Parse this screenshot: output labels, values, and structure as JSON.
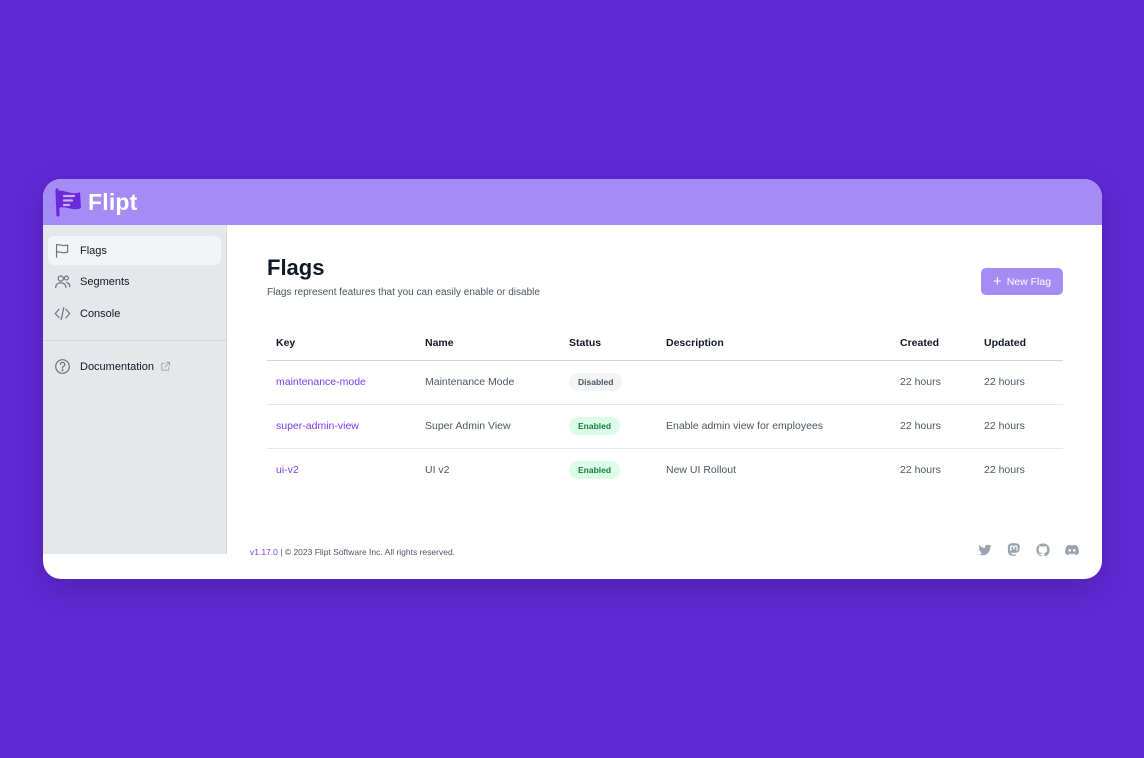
{
  "app": {
    "name": "Flipt"
  },
  "sidebar": {
    "items": [
      {
        "label": "Flags",
        "icon": "flag-icon",
        "active": true
      },
      {
        "label": "Segments",
        "icon": "users-icon",
        "active": false
      },
      {
        "label": "Console",
        "icon": "code-icon",
        "active": false
      }
    ],
    "documentation": {
      "label": "Documentation",
      "icon": "question-circle-icon"
    }
  },
  "main": {
    "title": "Flags",
    "subtitle": "Flags represent features that you can easily enable or disable",
    "new_button_label": "New Flag",
    "table": {
      "columns": [
        "Key",
        "Name",
        "Status",
        "Description",
        "Created",
        "Updated"
      ],
      "rows": [
        {
          "key": "maintenance-mode",
          "name": "Maintenance Mode",
          "status": "Disabled",
          "description": "",
          "created": "22 hours",
          "updated": "22 hours"
        },
        {
          "key": "super-admin-view",
          "name": "Super Admin View",
          "status": "Enabled",
          "description": "Enable admin view for employees",
          "created": "22 hours",
          "updated": "22 hours"
        },
        {
          "key": "ui-v2",
          "name": "UI v2",
          "status": "Enabled",
          "description": "New UI Rollout",
          "created": "22 hours",
          "updated": "22 hours"
        }
      ]
    }
  },
  "footer": {
    "version": "v1.17.0",
    "copyright": "| © 2023 Flipt Software Inc. All rights reserved.",
    "socials": [
      "twitter-icon",
      "mastodon-icon",
      "github-icon",
      "discord-icon"
    ]
  },
  "colors": {
    "background": "#6128d6",
    "accent": "#a58cf5",
    "link": "#7c3aed"
  }
}
